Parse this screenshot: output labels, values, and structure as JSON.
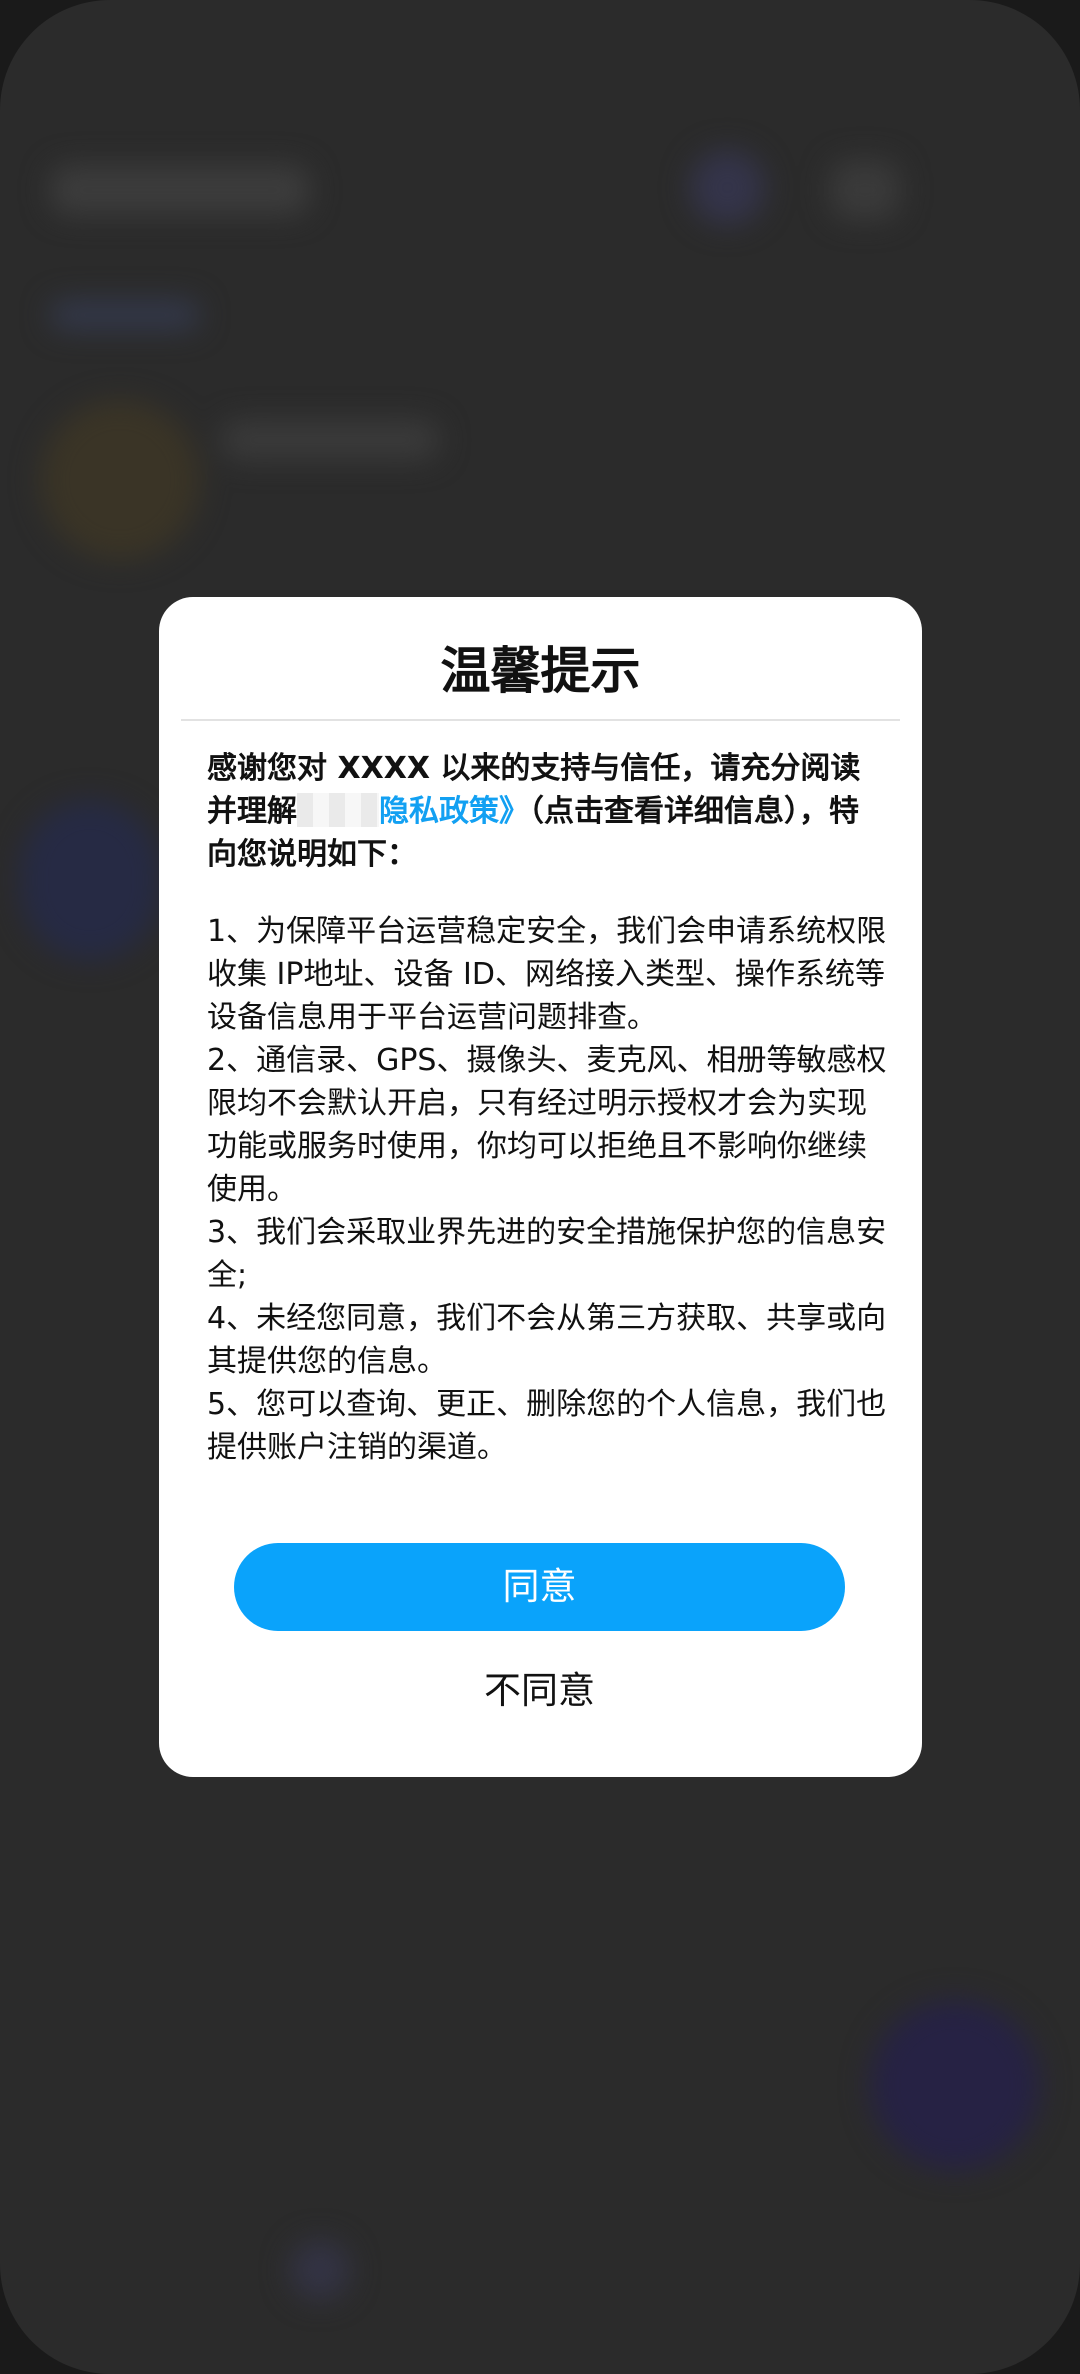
{
  "dialog": {
    "title": "温馨提示",
    "intro_prefix": "感谢您对 XXXX 以来的支持与信任，请充分阅读并理解",
    "policy_link": "隐私政策》",
    "intro_suffix": "（点击查看详细信息），特向您说明如下：",
    "points": [
      "1、为保障平台运营稳定安全，我们会申请系统权限收集 IP地址、设备 ID、网络接入类型、操作系统等设备信息用于平台运营问题排查。",
      "2、通信录、GPS、摄像头、麦克风、相册等敏感权限均不会默认开启，只有经过明示授权才会为实现功能或服务时使用，你均可以拒绝且不影响你继续使用。",
      "3、我们会采取业界先进的安全措施保护您的信息安全;",
      "4、未经您同意，我们不会从第三方获取、共享或向其提供您的信息。",
      "5、您可以查询、更正、删除您的个人信息，我们也提供账户注销的渠道。"
    ],
    "agree_label": "同意",
    "disagree_label": "不同意"
  },
  "colors": {
    "accent": "#0aa3fb",
    "link": "#12a0f2",
    "overlay": "#2b2b2b"
  }
}
